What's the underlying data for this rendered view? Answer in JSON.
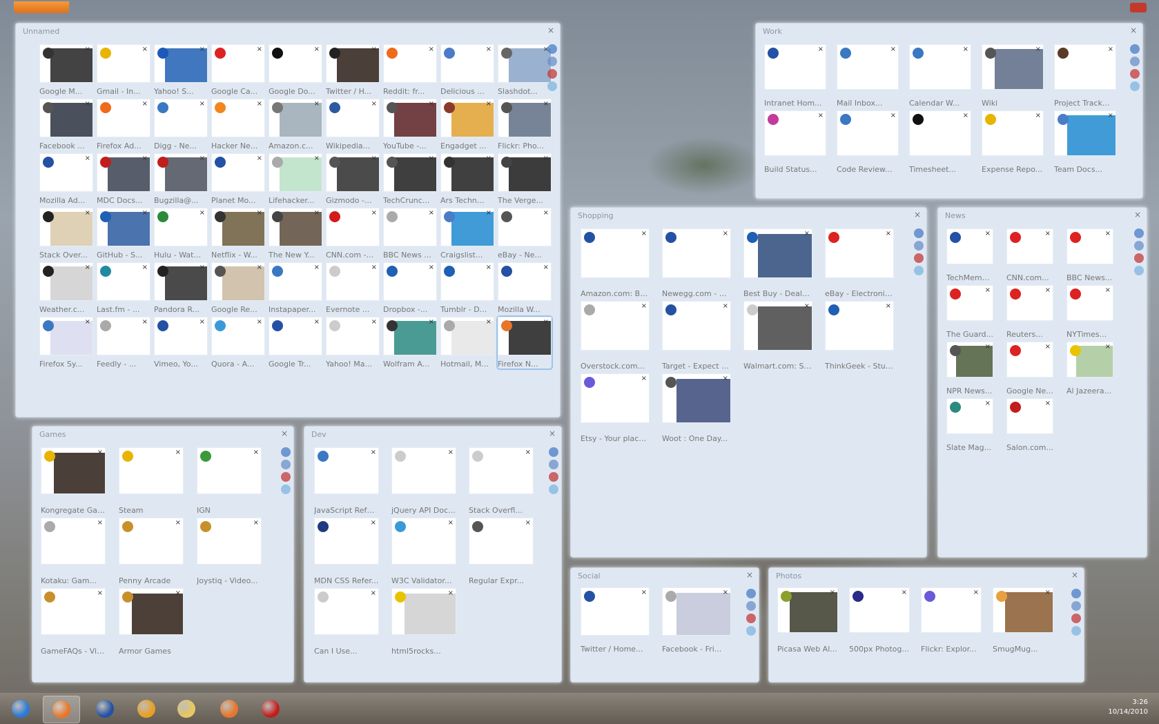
{
  "panels": [
    {
      "id": "main",
      "title": "Unnamed",
      "close": "×",
      "cols": 9,
      "tw": 78,
      "th": 56,
      "cw": 83,
      "ch": 79,
      "side": [
        "#4a7cc7",
        "#6a90c8",
        "#c43a3a",
        "#7fb6e0"
      ],
      "tiles": [
        {
          "label": "Google M...",
          "fav": "#333",
          "img": "#222"
        },
        {
          "label": "Gmail - In...",
          "fav": "#e8b400"
        },
        {
          "label": "Yahoo! S...",
          "fav": "#1e58b8",
          "img": "#1f5fb4"
        },
        {
          "label": "Google Ca...",
          "fav": "#d22"
        },
        {
          "label": "Google Do...",
          "fav": "#111"
        },
        {
          "label": "Twitter / H...",
          "fav": "#222",
          "img": "#2b1d16"
        },
        {
          "label": "Reddit: fr...",
          "fav": "#ef6a1b"
        },
        {
          "label": "Delicious ...",
          "fav": "#4a7cc7"
        },
        {
          "label": "Slashdot...",
          "fav": "#666",
          "img": "#8aa3c8"
        },
        {
          "label": "Facebook ...",
          "fav": "#555",
          "img": "#2a3140"
        },
        {
          "label": "Firefox Ad...",
          "fav": "#f06a1a"
        },
        {
          "label": "Digg - Ne...",
          "fav": "#3a78c2"
        },
        {
          "label": "Hacker Ne...",
          "fav": "#f0881f"
        },
        {
          "label": "Amazon.c...",
          "fav": "#777",
          "img": "#9aa8b4"
        },
        {
          "label": "Wikipedia...",
          "fav": "#2c5aa0"
        },
        {
          "label": "YouTube -...",
          "fav": "#555",
          "img": "#5a1f22"
        },
        {
          "label": "Engadget ...",
          "fav": "#8a3a2a",
          "img": "#e0a030"
        },
        {
          "label": "Flickr: Pho...",
          "fav": "#555",
          "img": "#5f6f86"
        },
        {
          "label": "Mozilla Ad...",
          "fav": "#2451a3"
        },
        {
          "label": "MDC Docs...",
          "fav": "#c21d1d",
          "img": "#3a4150"
        },
        {
          "label": "Bugzilla@...",
          "fav": "#c21d1d",
          "img": "#4a4f5a"
        },
        {
          "label": "Planet Mo...",
          "fav": "#2451a3"
        },
        {
          "label": "Lifehacker...",
          "fav": "#aaa",
          "img": "#b9e0c4"
        },
        {
          "label": "Gizmodo -...",
          "fav": "#555",
          "img": "#2b2b2b"
        },
        {
          "label": "TechCrunc...",
          "fav": "#555",
          "img": "#1d1d1d"
        },
        {
          "label": "Ars Techn...",
          "fav": "#333",
          "img": "#1f1f1f"
        },
        {
          "label": "The Verge...",
          "fav": "#444",
          "img": "#1a1a1a"
        },
        {
          "label": "Stack Over...",
          "fav": "#222",
          "img": "#d9c9a8"
        },
        {
          "label": "GitHub - S...",
          "fav": "#1f5fb4",
          "img": "#2c5aa0"
        },
        {
          "label": "Hulu - Wat...",
          "fav": "#2a8a3a"
        },
        {
          "label": "Netflix - W...",
          "fav": "#333",
          "img": "#6a5a3a"
        },
        {
          "label": "The New Y...",
          "fav": "#444",
          "img": "#5a4a3a"
        },
        {
          "label": "CNN.com -...",
          "fav": "#d21c1c"
        },
        {
          "label": "BBC News ...",
          "fav": "#aaa"
        },
        {
          "label": "Craigslist...",
          "fav": "#4a7cc7",
          "img": "#1f8ad0"
        },
        {
          "label": "eBay - Ne...",
          "fav": "#555"
        },
        {
          "label": "Weather.c...",
          "fav": "#222",
          "img": "#cfcfcf"
        },
        {
          "label": "Last.fm - ...",
          "fav": "#1f8aa0"
        },
        {
          "label": "Pandora R...",
          "fav": "#222",
          "img": "#2a2a2a"
        },
        {
          "label": "Google Re...",
          "fav": "#555",
          "img": "#c9b9a0"
        },
        {
          "label": "Instapaper...",
          "fav": "#3a78c2"
        },
        {
          "label": "Evernote ...",
          "fav": "#ccc"
        },
        {
          "label": "Dropbox -...",
          "fav": "#1f5fb4"
        },
        {
          "label": "Tumblr - D...",
          "fav": "#1f5fb4"
        },
        {
          "label": "Mozilla W...",
          "fav": "#2451a3"
        },
        {
          "label": "Firefox Sy...",
          "fav": "#3a78c2",
          "img": "#d9d9f0"
        },
        {
          "label": "Feedly - ...",
          "fav": "#aaa"
        },
        {
          "label": "Vimeo, Yo...",
          "fav": "#2451a3"
        },
        {
          "label": "Quora - A...",
          "fav": "#3a9ad8"
        },
        {
          "label": "Google Tr...",
          "fav": "#2451a3"
        },
        {
          "label": "Yahoo! Ma...",
          "fav": "#ccc"
        },
        {
          "label": "Wolfram A...",
          "fav": "#333",
          "img": "#2a8a80"
        },
        {
          "label": "Hotmail, M...",
          "fav": "#aaa",
          "img": "#e5e5e5"
        },
        {
          "label": "Firefox N...",
          "fav": "#e8762a",
          "img": "#1d1d1d",
          "selected": true
        }
      ]
    },
    {
      "id": "work",
      "title": "Work",
      "close": "×",
      "cols": 5,
      "tw": 90,
      "th": 66,
      "cw": 105,
      "ch": 96,
      "side": [
        "#4a7cc7",
        "#6a90c8",
        "#c43a3a",
        "#7fb6e0"
      ],
      "tiles": [
        {
          "label": "Intranet Hom...",
          "fav": "#2451a3"
        },
        {
          "label": "Mail Inbox...",
          "fav": "#3a78c2"
        },
        {
          "label": "Calendar W...",
          "fav": "#3a78c2"
        },
        {
          "label": "Wiki",
          "fav": "#555",
          "img": "#5a6a86"
        },
        {
          "label": "Project Track...",
          "fav": "#5a3a2a"
        },
        {
          "label": "Build Status...",
          "fav": "#c43a9a"
        },
        {
          "label": "Code Review...",
          "fav": "#3a78c2"
        },
        {
          "label": "Timesheet...",
          "fav": "#111"
        },
        {
          "label": "Expense Repo...",
          "fav": "#e8b400"
        },
        {
          "label": "Team Docs...",
          "fav": "#4a7cc7",
          "img": "#1f8ad0"
        }
      ]
    },
    {
      "id": "shopping",
      "title": "Shopping",
      "close": "×",
      "cols": 4,
      "tw": 100,
      "th": 72,
      "cw": 118,
      "ch": 105,
      "side": [
        "#4a7cc7",
        "#6a90c8",
        "#c43a3a",
        "#7fb6e0"
      ],
      "tiles": [
        {
          "label": "Amazon.com: Bo...",
          "fav": "#2451a3"
        },
        {
          "label": "Newegg.com - Co...",
          "fav": "#2451a3"
        },
        {
          "label": "Best Buy - Deals...",
          "fav": "#1f5fb4",
          "img": "#2d4a7a"
        },
        {
          "label": "eBay - Electronic...",
          "fav": "#d22"
        },
        {
          "label": "Overstock.com...",
          "fav": "#aaa"
        },
        {
          "label": "Target - Expect M...",
          "fav": "#2451a3"
        },
        {
          "label": "Walmart.com: Sav...",
          "fav": "#ccc",
          "img": "#444"
        },
        {
          "label": "ThinkGeek - Stuff...",
          "fav": "#1f5fb4"
        },
        {
          "label": "Etsy - Your place...",
          "fav": "#6a5ad8"
        },
        {
          "label": "Woot : One Day...",
          "fav": "#555",
          "img": "#3a4a7a"
        }
      ]
    },
    {
      "id": "news",
      "title": "News",
      "close": "×",
      "cols": 3,
      "tw": 68,
      "th": 52,
      "cw": 87,
      "ch": 82,
      "side": [
        "#4a7cc7",
        "#6a90c8",
        "#c43a3a",
        "#7fb6e0"
      ],
      "tiles": [
        {
          "label": "TechMeme...",
          "fav": "#2451a3"
        },
        {
          "label": "CNN.com...",
          "fav": "#d22"
        },
        {
          "label": "BBC News...",
          "fav": "#d22"
        },
        {
          "label": "The Guard...",
          "fav": "#d22"
        },
        {
          "label": "Reuters...",
          "fav": "#d22"
        },
        {
          "label": "NYTimes...",
          "fav": "#d22"
        },
        {
          "label": "NPR News...",
          "fav": "#555",
          "img": "#4a5a3a"
        },
        {
          "label": "Google Ne...",
          "fav": "#d22"
        },
        {
          "label": "Al Jazeera...",
          "fav": "#e8c400",
          "img": "#a8c89a"
        },
        {
          "label": "Slate Mag...",
          "fav": "#2a8a80"
        },
        {
          "label": "Salon.com...",
          "fav": "#c21d1d"
        }
      ]
    },
    {
      "id": "gaming",
      "title": "Games",
      "close": "×",
      "cols": 3,
      "tw": 94,
      "th": 68,
      "cw": 113,
      "ch": 102,
      "side": [
        "#4a7cc7",
        "#6a90c8",
        "#c43a3a",
        "#7fb6e0"
      ],
      "tiles": [
        {
          "label": "Kongregate Gam...",
          "fav": "#e8b400",
          "img": "#2a1e16"
        },
        {
          "label": "Steam",
          "fav": "#e8b400"
        },
        {
          "label": "IGN",
          "fav": "#3a9a3a"
        },
        {
          "label": "Kotaku: Gam...",
          "fav": "#aaa"
        },
        {
          "label": "Penny Arcade",
          "fav": "#c8902a"
        },
        {
          "label": "Joystiq - Video...",
          "fav": "#c8902a"
        },
        {
          "label": "GameFAQs - Vid...",
          "fav": "#c8902a"
        },
        {
          "label": "Armor Games",
          "fav": "#c8902a",
          "img": "#2d1f15"
        }
      ]
    },
    {
      "id": "dev",
      "title": "Dev",
      "close": "×",
      "cols": 3,
      "tw": 94,
      "th": 68,
      "cw": 112,
      "ch": 102,
      "side": [
        "#4a7cc7",
        "#6a90c8",
        "#c43a3a",
        "#7fb6e0"
      ],
      "tiles": [
        {
          "label": "JavaScript Refer...",
          "fav": "#3a78c2"
        },
        {
          "label": "jQuery API Doc...",
          "fav": "#ccc"
        },
        {
          "label": "Stack Overfl...",
          "fav": "#ccc"
        },
        {
          "label": "MDN CSS Refer...",
          "fav": "#1f3a80"
        },
        {
          "label": "W3C Validator...",
          "fav": "#3a9ad8"
        },
        {
          "label": "Regular Expr...",
          "fav": "#555"
        },
        {
          "label": "Can I Use...",
          "fav": "#ccc"
        },
        {
          "label": "html5rocks...",
          "fav": "#e8c400",
          "img": "#cfcfcf"
        }
      ]
    },
    {
      "id": "social",
      "title": "Social",
      "close": "×",
      "cols": 2,
      "tw": 100,
      "th": 70,
      "cw": 118,
      "ch": 100,
      "side": [
        "#4a7cc7",
        "#6a90c8",
        "#c43a3a",
        "#7fb6e0"
      ],
      "tiles": [
        {
          "label": "Twitter / Home...",
          "fav": "#2451a3"
        },
        {
          "label": "Facebook - Fri...",
          "fav": "#aaa",
          "img": "#c0c4d8"
        }
      ]
    },
    {
      "id": "photos",
      "title": "Photos",
      "close": "×",
      "cols": 4,
      "tw": 88,
      "th": 66,
      "cw": 104,
      "ch": 100,
      "side": [
        "#4a7cc7",
        "#6a90c8",
        "#c43a3a",
        "#7fb6e0"
      ],
      "tiles": [
        {
          "label": "Picasa Web Al...",
          "fav": "#8aa02a",
          "img": "#3a3a2a"
        },
        {
          "label": "500px Photog...",
          "fav": "#2a2a8a"
        },
        {
          "label": "Flickr: Explor...",
          "fav": "#6a5ad8"
        },
        {
          "label": "SmugMug...",
          "fav": "#e8a040",
          "img": "#8a5a30"
        }
      ]
    }
  ],
  "taskbar": {
    "items": [
      {
        "name": "start-button",
        "color": "#2a7ad8"
      },
      {
        "name": "firefox-taskbar-icon",
        "color": "#e8762a",
        "active": true
      },
      {
        "name": "thunderbird-taskbar-icon",
        "color": "#2451a3"
      },
      {
        "name": "media-taskbar-icon",
        "color": "#e8a020"
      },
      {
        "name": "folder-taskbar-icon",
        "color": "#e8c860"
      },
      {
        "name": "vlc-taskbar-icon",
        "color": "#e8762a"
      },
      {
        "name": "opera-taskbar-icon",
        "color": "#c21d1d"
      }
    ],
    "clock_time": "3:26",
    "clock_date": "10/14/2010"
  }
}
